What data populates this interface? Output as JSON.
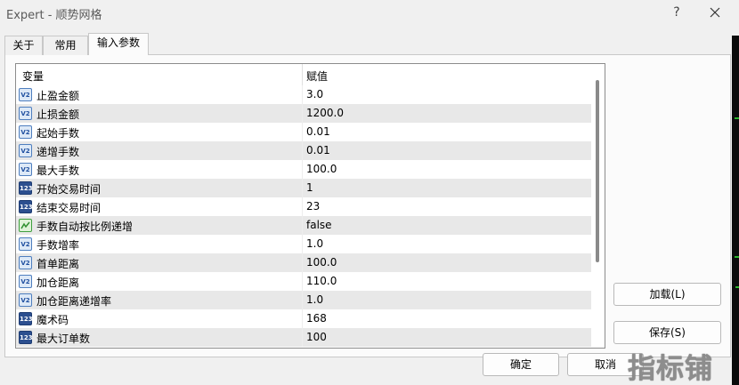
{
  "window": {
    "title": "Expert - 顺势网格",
    "help_label": "?"
  },
  "tabs": [
    {
      "label": "关于",
      "active": false
    },
    {
      "label": "常用",
      "active": false
    },
    {
      "label": "输入参数",
      "active": true
    }
  ],
  "grid": {
    "columns": {
      "variable": "变量",
      "value": "赋值"
    },
    "rows": [
      {
        "icon": "double-value-icon",
        "name": "止盈金额",
        "value": "3.0"
      },
      {
        "icon": "double-value-icon",
        "name": "止损金额",
        "value": "1200.0"
      },
      {
        "icon": "double-value-icon",
        "name": "起始手数",
        "value": "0.01"
      },
      {
        "icon": "double-value-icon",
        "name": "递增手数",
        "value": "0.01"
      },
      {
        "icon": "double-value-icon",
        "name": "最大手数",
        "value": "100.0"
      },
      {
        "icon": "integer-value-icon",
        "name": "开始交易时间",
        "value": "1"
      },
      {
        "icon": "integer-value-icon",
        "name": "结束交易时间",
        "value": "23"
      },
      {
        "icon": "boolean-value-icon",
        "name": "手数自动按比例递增",
        "value": "false"
      },
      {
        "icon": "double-value-icon",
        "name": "手数增率",
        "value": "1.0"
      },
      {
        "icon": "double-value-icon",
        "name": "首单距离",
        "value": "100.0"
      },
      {
        "icon": "double-value-icon",
        "name": "加仓距离",
        "value": "110.0"
      },
      {
        "icon": "double-value-icon",
        "name": "加仓距离递增率",
        "value": "1.0"
      },
      {
        "icon": "integer-value-icon",
        "name": "魔术码",
        "value": "168"
      },
      {
        "icon": "integer-value-icon",
        "name": "最大订单数",
        "value": "100"
      }
    ]
  },
  "buttons": {
    "load": "加载(L)",
    "save": "保存(S)",
    "ok": "确定",
    "cancel": "取消"
  },
  "watermark": "指标铺",
  "colors": {
    "row_alt": "#e8e8e8",
    "icon_double": "#4f7fbf",
    "icon_integer": "#2c4f8f",
    "icon_boolean": "#3f9f3f"
  }
}
